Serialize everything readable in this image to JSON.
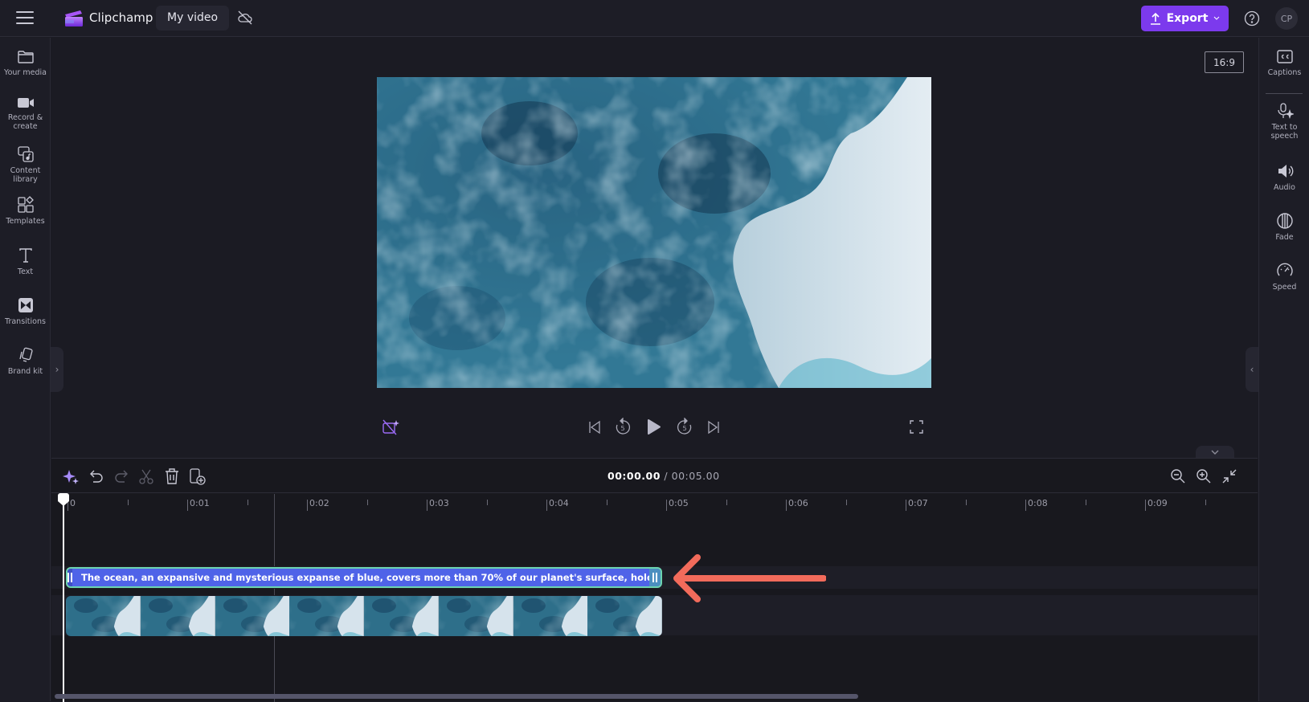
{
  "app": {
    "brand": "Clipchamp",
    "project_title": "My video",
    "accent_color": "#7c3aed",
    "caption_clip_color": "#4f63e8",
    "caption_clip_border": "#6cd4b0",
    "annotation_arrow_color": "#f26b5b"
  },
  "topbar": {
    "menu_icon": "hamburger-icon",
    "cloud_status_icon": "cloud-off-icon",
    "export_label": "Export",
    "help_icon": "help-icon",
    "avatar_initials": "CP"
  },
  "left_rail": {
    "items": [
      {
        "label": "Your media",
        "icon": "folder-icon"
      },
      {
        "label": "Record & create",
        "icon": "video-camera-icon"
      },
      {
        "label": "Content library",
        "icon": "content-library-icon"
      },
      {
        "label": "Templates",
        "icon": "templates-icon"
      },
      {
        "label": "Text",
        "icon": "text-icon"
      },
      {
        "label": "Transitions",
        "icon": "transitions-icon"
      },
      {
        "label": "Brand kit",
        "icon": "brand-kit-icon"
      }
    ]
  },
  "right_rail": {
    "items": [
      {
        "label": "Captions",
        "icon": "captions-icon"
      },
      {
        "label": "Text to speech",
        "icon": "text-to-speech-icon"
      },
      {
        "label": "Audio",
        "icon": "audio-icon"
      },
      {
        "label": "Fade",
        "icon": "fade-icon"
      },
      {
        "label": "Speed",
        "icon": "speed-icon"
      }
    ]
  },
  "preview": {
    "aspect_ratio": "16:9"
  },
  "timeline": {
    "current_time": "00:00.00",
    "separator": "/",
    "total_time": "00:05.00",
    "ruler_labels": [
      "0",
      "0:01",
      "0:02",
      "0:03",
      "0:04",
      "0:05",
      "0:06",
      "0:07",
      "0:08",
      "0:09"
    ],
    "caption_clip_text": "The ocean, an expansive and mysterious expanse of blue, covers more than 70% of our planet's surface, holding within its depths",
    "video_clip_thumbnails": 8
  }
}
